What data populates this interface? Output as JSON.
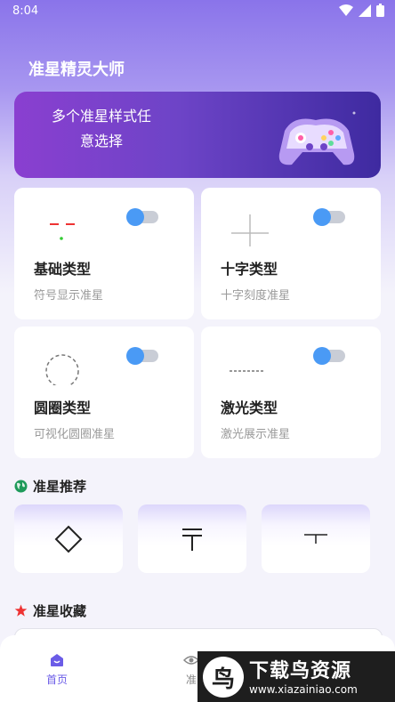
{
  "status": {
    "time": "8:04"
  },
  "app": {
    "title": "准星精灵大师"
  },
  "banner": {
    "line1": "多个准星样式任",
    "line2": "意选择"
  },
  "cards": [
    {
      "name": "基础类型",
      "desc": "符号显示准星",
      "enabled": false
    },
    {
      "name": "十字类型",
      "desc": "十字刻度准星",
      "enabled": false
    },
    {
      "name": "圆圈类型",
      "desc": "可视化圆圈准星",
      "enabled": false
    },
    {
      "name": "激光类型",
      "desc": "激光展示准星",
      "enabled": false
    }
  ],
  "sections": {
    "recommend": "准星推荐",
    "favorites": "准星收藏"
  },
  "tabs": [
    {
      "label": "首页",
      "icon": "home-icon",
      "active": true
    },
    {
      "label": "准",
      "icon": "eye-icon",
      "active": false
    }
  ],
  "watermark": {
    "logo": "鸟",
    "title": "下载鸟资源",
    "url": "www.xiazainiao.com"
  },
  "colors": {
    "accent": "#4a9af5",
    "active_tab": "#6b5ce7"
  }
}
